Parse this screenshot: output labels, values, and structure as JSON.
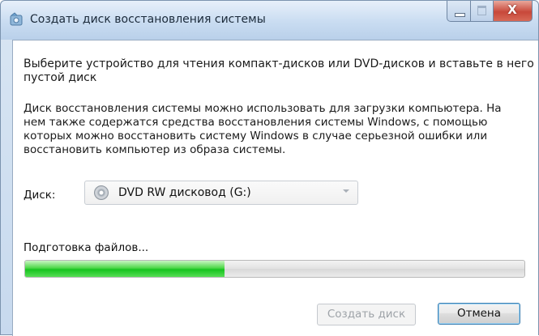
{
  "window": {
    "title": "Создать диск восстановления системы",
    "close_glyph": "X"
  },
  "content": {
    "instruction": "Выберите устройство для чтения компакт-дисков или DVD-дисков и вставьте в него пустой диск",
    "description": "Диск восстановления системы можно использовать для загрузки компьютера. На нем также содержатся средства восстановления системы Windows, с помощью которых можно восстановить систему Windows в случае серьезной ошибки или восстановить компьютер из образа системы.",
    "disk_label": "Диск:",
    "disk_value": "DVD RW дисковод (G:)",
    "status": "Подготовка файлов...",
    "progress_fraction": 0.4
  },
  "buttons": {
    "create": "Создать диск",
    "cancel": "Отмена"
  },
  "colors": {
    "progress_fill": "#17c41f",
    "accent_border": "#3c7fb1"
  },
  "icons": {
    "title": "recovery-disc-icon",
    "disk": "dvd-drive-icon"
  }
}
